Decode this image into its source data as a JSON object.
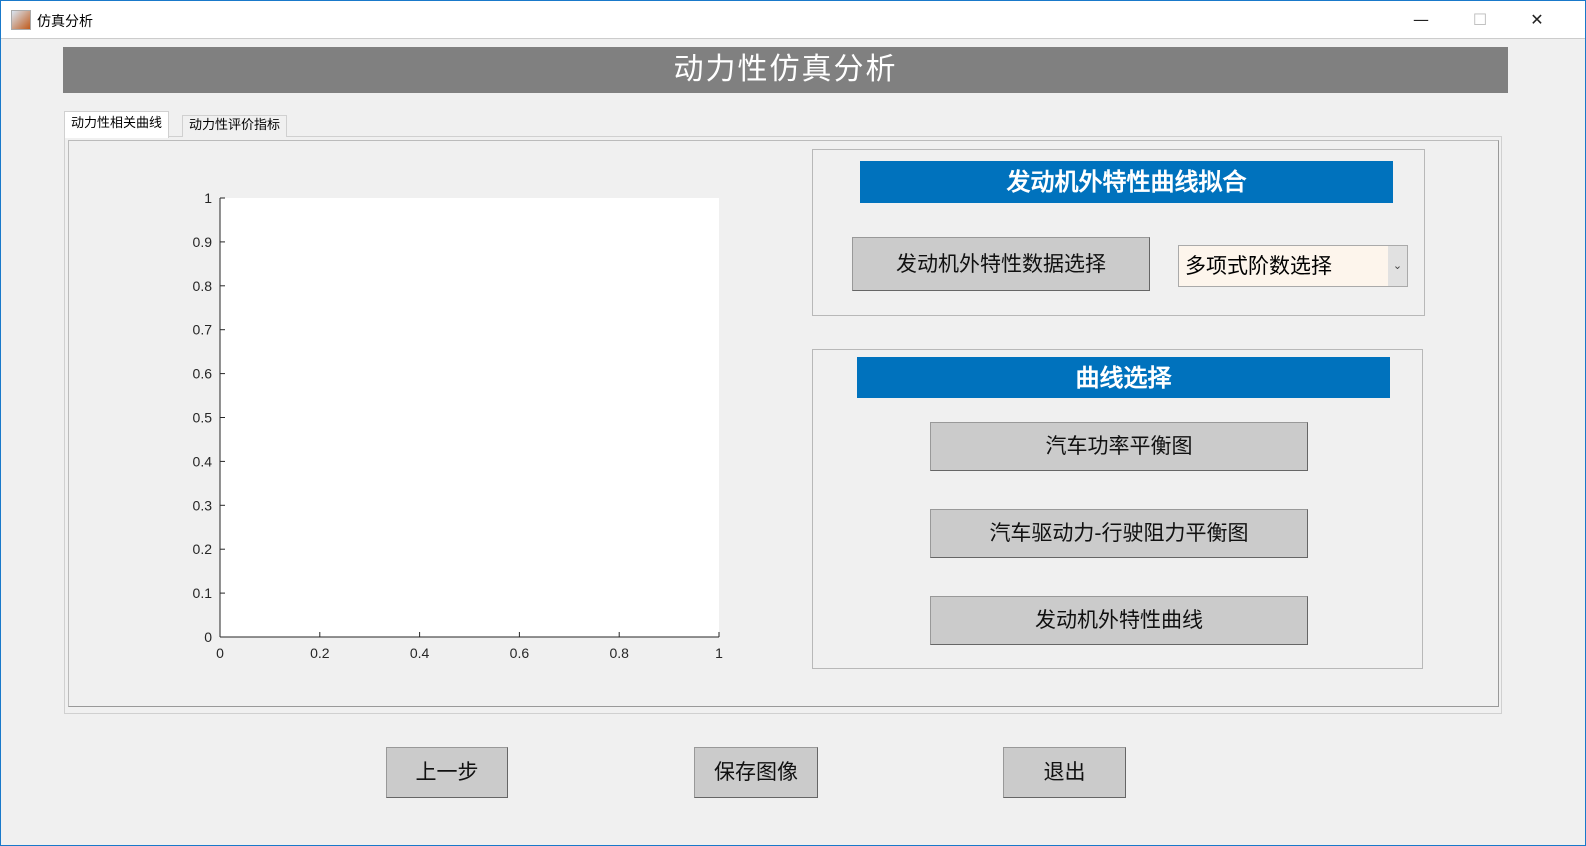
{
  "window": {
    "title": "仿真分析",
    "minimize": "—",
    "maximize": "☐",
    "close": "✕"
  },
  "header": {
    "title": "动力性仿真分析"
  },
  "tabs": [
    {
      "label": "动力性相关曲线",
      "active": true
    },
    {
      "label": "动力性评价指标",
      "active": false
    }
  ],
  "fit_panel": {
    "title": "发动机外特性曲线拟合",
    "data_button": "发动机外特性数据选择",
    "order_select": {
      "value": "多项式阶数选择"
    }
  },
  "curve_panel": {
    "title": "曲线选择",
    "buttons": [
      "汽车功率平衡图",
      "汽车驱动力-行驶阻力平衡图",
      "发动机外特性曲线"
    ]
  },
  "footer": {
    "prev": "上一步",
    "save": "保存图像",
    "exit": "退出"
  },
  "chart_data": {
    "type": "line",
    "series": [],
    "xlim": [
      0,
      1
    ],
    "ylim": [
      0,
      1
    ],
    "xticks": [
      "0",
      "0.2",
      "0.4",
      "0.6",
      "0.8",
      "1"
    ],
    "yticks": [
      "0",
      "0.1",
      "0.2",
      "0.3",
      "0.4",
      "0.5",
      "0.6",
      "0.7",
      "0.8",
      "0.9",
      "1"
    ],
    "title": "",
    "xlabel": "",
    "ylabel": ""
  },
  "colors": {
    "accent": "#0072bd",
    "header": "#808080"
  }
}
